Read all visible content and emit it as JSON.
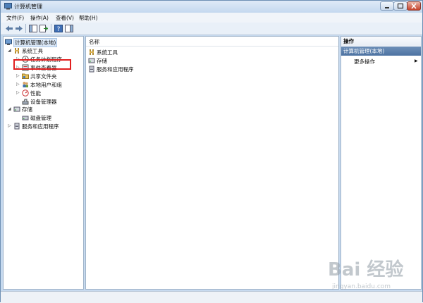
{
  "window": {
    "title": "计算机管理"
  },
  "menu": [
    "文件(F)",
    "操作(A)",
    "查看(V)",
    "帮助(H)"
  ],
  "tree": {
    "root": "计算机管理(本地)",
    "system_tools": "系统工具",
    "task_scheduler": "任务计划程序",
    "event_viewer": "事件查看器",
    "shared_folders": "共享文件夹",
    "local_users": "本地用户和组",
    "performance": "性能",
    "device_manager": "设备管理器",
    "storage": "存储",
    "disk_management": "磁盘管理",
    "services_apps": "服务和应用程序"
  },
  "list": {
    "column_name": "名称",
    "items": [
      "系统工具",
      "存储",
      "服务和应用程序"
    ]
  },
  "actions": {
    "title": "操作",
    "section": "计算机管理(本地)",
    "more": "更多操作"
  },
  "watermark": {
    "text": "Bai 经验",
    "url": "jingyan.baidu.com"
  }
}
